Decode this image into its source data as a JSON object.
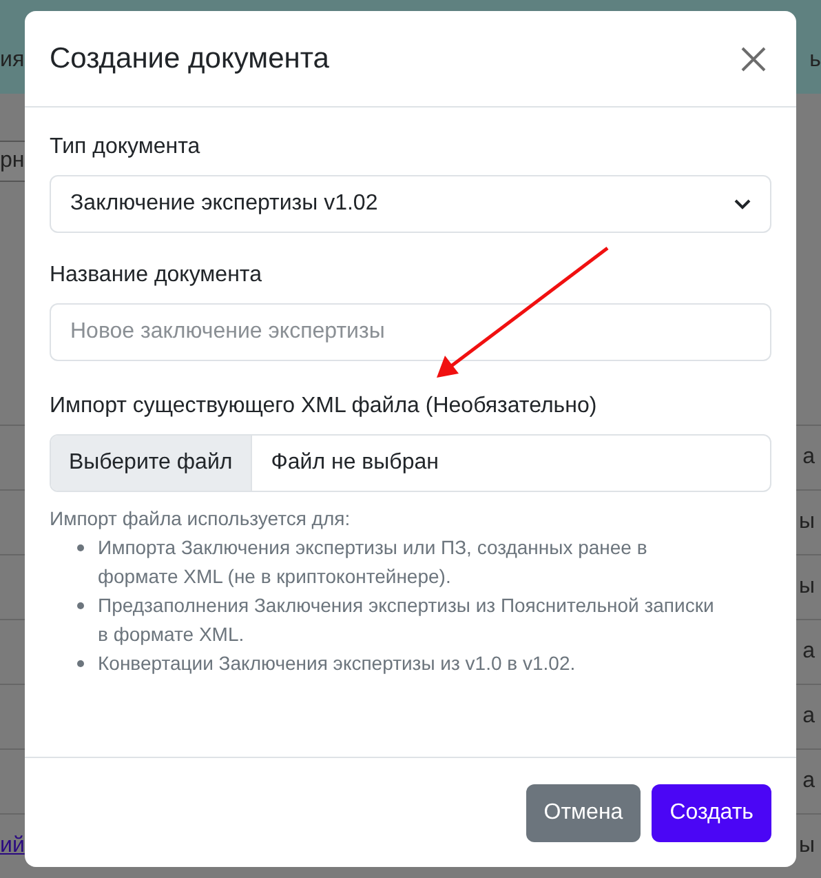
{
  "background": {
    "banner_row": {
      "left": "ия",
      "right": "ь"
    },
    "toolbar_left": "рн",
    "rows": [
      {
        "right": "а"
      },
      {
        "right": "ы"
      },
      {
        "right": "ы"
      },
      {
        "right": "а"
      },
      {
        "right": "а"
      },
      {
        "right": "а"
      },
      {
        "left": "ий",
        "right": "ы"
      }
    ]
  },
  "modal": {
    "title": "Создание документа",
    "doc_type": {
      "label": "Тип документа",
      "value": "Заключение экспертизы v1.02"
    },
    "doc_name": {
      "label": "Название документа",
      "placeholder": "Новое заключение экспертизы"
    },
    "import": {
      "label": "Импорт существующего XML файла (Необязательно)",
      "button": "Выберите файл",
      "status": "Файл не выбран"
    },
    "help": {
      "intro": "Импорт файла используется для:",
      "items": [
        "Импорта Заключения экспертизы или ПЗ, созданных ранее в формате XML (не в криптоконтейнере).",
        "Предзаполнения Заключения экспертизы из Пояснительной записки в формате XML.",
        "Конвертации Заключения экспертизы из v1.0 в v1.02."
      ]
    },
    "buttons": [
      {
        "kind": "secondary",
        "label": "Отмена"
      },
      {
        "kind": "primary",
        "label": "Создать"
      }
    ]
  }
}
